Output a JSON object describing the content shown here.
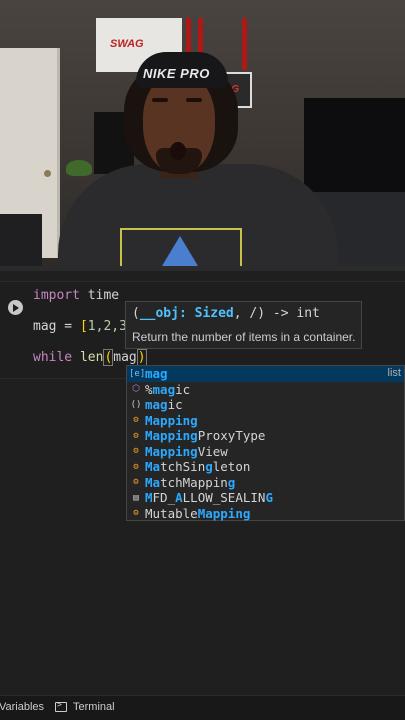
{
  "code": {
    "line1": {
      "kw": "import",
      "rest": " time"
    },
    "line2": {
      "var": "mag = ",
      "bracket": "[",
      "nums": "1,2,3,",
      "tail": ""
    },
    "line3": {
      "kw": "while",
      "sp": " ",
      "fn": "len",
      "open": "(",
      "arg": "mag",
      "close": ")"
    }
  },
  "hover": {
    "open": "(",
    "param": "__obj: Sized",
    "rest": ", /) -> int",
    "doc": "Return the number of items in a container."
  },
  "suggestions": [
    {
      "icon": "[e]",
      "kind": "variable",
      "pre": "",
      "match": "mag",
      "post": "",
      "detail": "list",
      "active": true
    },
    {
      "icon": "⬡",
      "kind": "magic",
      "pre": "%",
      "match": "ma",
      "post": "",
      "mid": "g",
      "tail": "ic",
      "detail": ""
    },
    {
      "icon": "()",
      "kind": "magic",
      "pre": "",
      "match": "mag",
      "post": "ic",
      "detail": ""
    },
    {
      "icon": "⚙",
      "kind": "class",
      "pre": "",
      "match": "Mapping",
      "post": "",
      "detail": ""
    },
    {
      "icon": "⚙",
      "kind": "class",
      "pre": "",
      "match": "Mapping",
      "post": "ProxyType",
      "detail": ""
    },
    {
      "icon": "⚙",
      "kind": "class",
      "pre": "",
      "match": "Mapping",
      "post": "View",
      "detail": ""
    },
    {
      "icon": "⚙",
      "kind": "class",
      "pre": "",
      "match": "Ma",
      "post": "tchSin",
      "mid": "g",
      "tail": "leton",
      "detail": ""
    },
    {
      "icon": "⚙",
      "kind": "class",
      "pre": "",
      "match": "Ma",
      "post": "tchMappin",
      "mid": "g",
      "tail": "",
      "detail": ""
    },
    {
      "icon": "▤",
      "kind": "const",
      "pre": "",
      "match": "M",
      "post": "FD_",
      "mid": "A",
      "tail": "LLOW_SEALIN",
      "last": "G",
      "detail": ""
    },
    {
      "icon": "⚙",
      "kind": "class",
      "pre": "",
      "match": "M",
      "post": "utable",
      "mid": "Mapping",
      "tail": "",
      "detail": ""
    }
  ],
  "statusbar": {
    "variables": "Variables",
    "terminal": "Terminal"
  },
  "webcam": {
    "poster_text": "SWAG",
    "headband_text": "NIKE PRO",
    "sign_text": "AG"
  }
}
